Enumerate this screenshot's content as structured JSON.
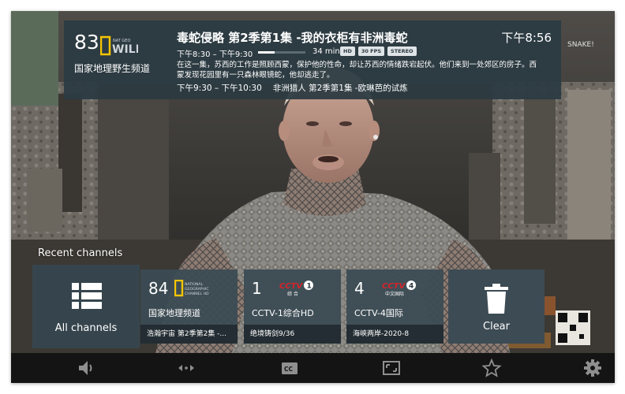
{
  "channel": {
    "number": "83",
    "name": "国家地理野生频道",
    "logo_text": "WILD",
    "logo_subtext": "NAT GEO"
  },
  "program": {
    "title": "毒蛇侵略 第2季第1集 -我的衣柜有非洲毒蛇",
    "time_range": "下午8:30 – 下午9:30",
    "progress": 0.35,
    "duration": "34 min",
    "badges": [
      "HD",
      "30 FPS",
      "STEREO"
    ],
    "description": "在这一集，苏西的工作是照顾西蒙，保护他的性命，却让苏西的情绪跌宕起伏。他们来到一处郊区的房子。西蒙发现花园里有一只森林眼镜蛇，他却逃走了。"
  },
  "next_program": {
    "time_range": "下午9:30 – 下午10:30",
    "title": "非洲猎人 第2季第1集 -欧琳芭的试炼"
  },
  "clock": "下午8:56",
  "recent": {
    "label": "Recent channels",
    "all_channels_label": "All channels",
    "clear_label": "Clear",
    "channels": [
      {
        "number": "84",
        "name": "国家地理频道",
        "program": "浩瀚宇宙 第2季第2集 -...",
        "logo_text": "NATIONAL GEOGRAPHIC CHANNEL"
      },
      {
        "number": "1",
        "name": "CCTV-1综合HD",
        "program": "绝境铸剑9/36",
        "logo_text": "CCTV",
        "logo_badge": "1",
        "logo_sub": "综合"
      },
      {
        "number": "4",
        "name": "CCTV-4国际",
        "program": "海峡两岸-2020-8",
        "logo_text": "CCTV",
        "logo_badge": "4",
        "logo_sub": "中文国际"
      }
    ]
  },
  "controls": [
    "volume-icon",
    "audio-track-icon",
    "closed-captions-icon",
    "aspect-ratio-icon",
    "favorite-star-icon",
    "settings-gear-icon"
  ],
  "colors": {
    "panel_bg": "#2c3a42",
    "tile_bg": "#3c4b54",
    "logo_yellow": "#f7c600",
    "cctv_red": "#d7232a"
  }
}
